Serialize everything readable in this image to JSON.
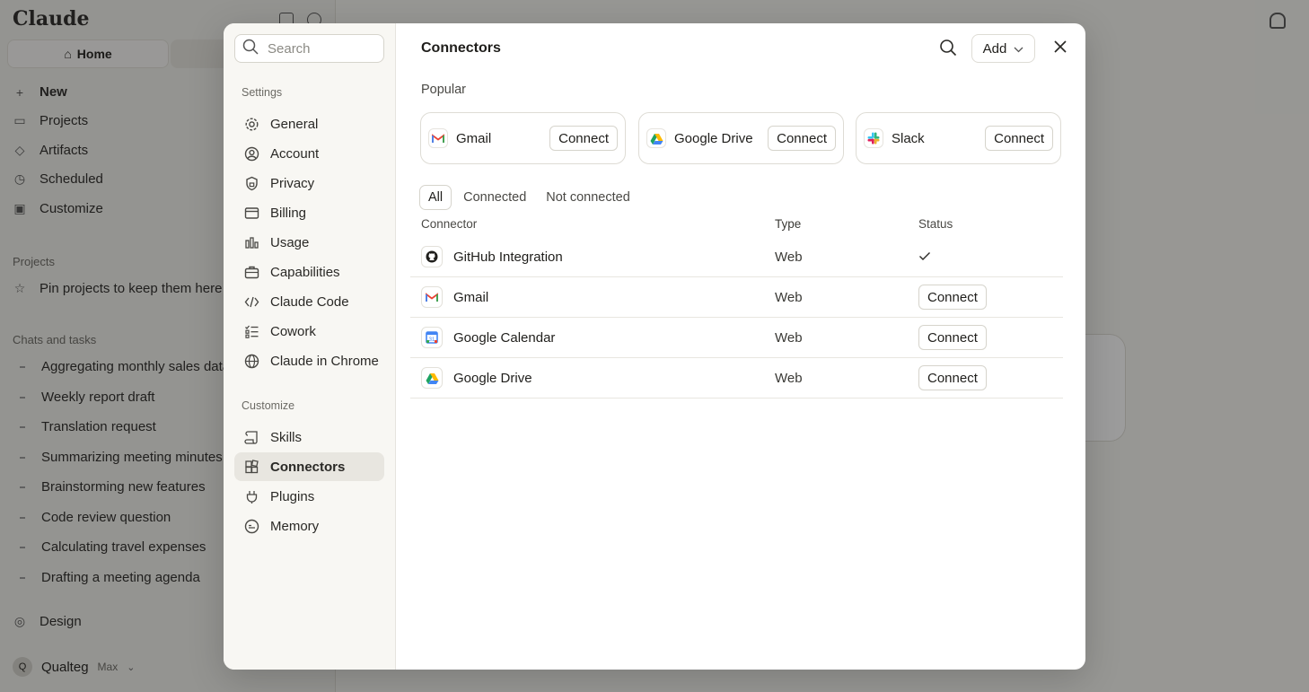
{
  "background": {
    "logo": "Claude",
    "home_label": "Home",
    "nav": [
      "New",
      "Projects",
      "Artifacts",
      "Scheduled",
      "Customize"
    ],
    "projects_heading": "Projects",
    "projects_hint": "Pin projects to keep them here",
    "chats_heading": "Chats and tasks",
    "chats": [
      "Aggregating monthly sales data",
      "Weekly report draft",
      "Translation request",
      "Summarizing meeting minutes",
      "Brainstorming new features",
      "Code review question",
      "Calculating travel expenses",
      "Drafting a meeting agenda"
    ],
    "design_label": "Design",
    "user_initial": "Q",
    "user_name": "Qualteg",
    "user_plan": "Max"
  },
  "modal": {
    "search_placeholder": "Search",
    "settings_heading": "Settings",
    "settings_items": [
      {
        "label": "General",
        "icon": "gear-icon"
      },
      {
        "label": "Account",
        "icon": "user-circle-icon"
      },
      {
        "label": "Privacy",
        "icon": "shield-lock-icon"
      },
      {
        "label": "Billing",
        "icon": "credit-card-icon"
      },
      {
        "label": "Usage",
        "icon": "bar-chart-icon"
      },
      {
        "label": "Capabilities",
        "icon": "briefcase-icon"
      },
      {
        "label": "Claude Code",
        "icon": "code-icon"
      },
      {
        "label": "Cowork",
        "icon": "checklist-icon"
      },
      {
        "label": "Claude in Chrome",
        "icon": "globe-icon"
      }
    ],
    "customize_heading": "Customize",
    "customize_items": [
      {
        "label": "Skills",
        "icon": "scroll-icon"
      },
      {
        "label": "Connectors",
        "icon": "blocks-icon",
        "active": true
      },
      {
        "label": "Plugins",
        "icon": "plug-icon"
      },
      {
        "label": "Memory",
        "icon": "memory-icon"
      }
    ],
    "title": "Connectors",
    "add_label": "Add",
    "popular_heading": "Popular",
    "popular": [
      {
        "name": "Gmail",
        "button": "Connect",
        "icon": "gmail-icon"
      },
      {
        "name": "Google Drive",
        "button": "Connect",
        "icon": "google-drive-icon"
      },
      {
        "name": "Slack",
        "button": "Connect",
        "icon": "slack-icon"
      }
    ],
    "tabs": [
      "All",
      "Connected",
      "Not connected"
    ],
    "active_tab": "All",
    "columns": [
      "Connector",
      "Type",
      "Status"
    ],
    "rows": [
      {
        "name": "GitHub Integration",
        "type": "Web",
        "status": "connected",
        "icon": "github-icon"
      },
      {
        "name": "Gmail",
        "type": "Web",
        "status": "Connect",
        "icon": "gmail-icon"
      },
      {
        "name": "Google Calendar",
        "type": "Web",
        "status": "Connect",
        "icon": "google-calendar-icon"
      },
      {
        "name": "Google Drive",
        "type": "Web",
        "status": "Connect",
        "icon": "google-drive-icon"
      }
    ]
  },
  "colors": {
    "accent_background": "#e8e6e0",
    "overlay": "rgba(20,20,18,0.42)",
    "gmail_red": "#ea4335",
    "drive_green": "#1ea362",
    "drive_yellow": "#ffba00",
    "drive_blue": "#4285f4"
  }
}
